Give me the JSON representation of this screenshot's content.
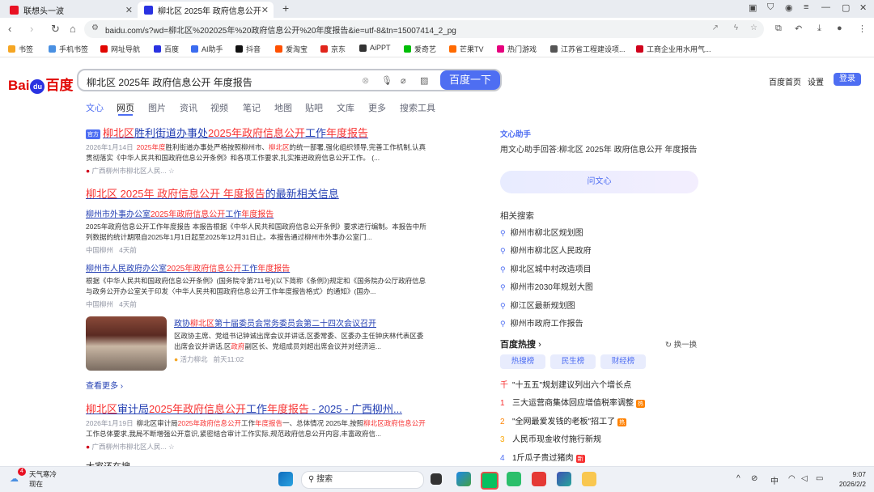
{
  "browser": {
    "tabs": [
      {
        "label": "联想头一波",
        "active": false
      },
      {
        "label": "柳北区 2025年 政府信息公开 年度",
        "active": true
      }
    ],
    "new_tab_glyph": "+",
    "url": "baidu.com/s?wd=柳北区%202025年%20政府信息公开%20年度报告&ie=utf-8&tn=15007414_2_pg",
    "bookmarks": [
      {
        "label": "书签",
        "color": "#f5a623"
      },
      {
        "label": "手机书签",
        "color": "#4a90e2"
      },
      {
        "label": "网址导航",
        "color": "#e10602"
      },
      {
        "label": "百度",
        "color": "#2932e1"
      },
      {
        "label": "AI助手",
        "color": "#3b6cf0"
      },
      {
        "label": "抖音",
        "color": "#111111"
      },
      {
        "label": "爱淘宝",
        "color": "#ff5000"
      },
      {
        "label": "京东",
        "color": "#e1251b"
      },
      {
        "label": "AiPPT",
        "color": "#333333"
      },
      {
        "label": "爱奇艺",
        "color": "#00be06"
      },
      {
        "label": "芒果TV",
        "color": "#ff6a00"
      },
      {
        "label": "热门游戏",
        "color": "#e6007e"
      },
      {
        "label": "江苏省工程建设项...",
        "color": "#555555"
      },
      {
        "label": "工商企业用水用气...",
        "color": "#d0021b"
      }
    ]
  },
  "search": {
    "logo_left": "Bai",
    "logo_du": "du",
    "logo_right": "百度",
    "query": "柳北区 2025年 政府信息公开 年度报告",
    "button": "百度一下",
    "links": [
      "百度首页",
      "设置"
    ],
    "login": "登录",
    "tabs": [
      "文心",
      "网页",
      "图片",
      "资讯",
      "视频",
      "笔记",
      "地图",
      "贴吧",
      "文库",
      "更多",
      "搜索工具"
    ]
  },
  "results": {
    "r1": {
      "badge": "官方",
      "t1": "柳北区",
      "t2": "胜利街道办事处",
      "t3": "2025年政府信息公开",
      "t4": "工作",
      "t5": "年度报告",
      "date": "2026年1月14日",
      "d1": "2025年度",
      "d2": "胜利街道办事处严格按照柳州市、",
      "d3": "柳北区",
      "d4": "的统一部署,强化组织领导,完善工作机制,认真贯彻落实《中华人民共和国政府信息公开条例》和各项工作要求,扎实推进政府信息公开工作。 (...",
      "source": "广西柳州市柳北区人民..."
    },
    "r2": {
      "title_em": "柳北区 2025年 政府信息公开 年度报告",
      "title_rest": "的最新相关信息",
      "a_t1": "柳州市外事办公室",
      "a_t2": "2025年政府信息公开",
      "a_t3": "工作",
      "a_t4": "年度报告",
      "a_desc": "2025年政府信息公开工作年度报告   本报告根据《中华人民共和国政府信息公开条例》要求进行编制。本报告中所列数据的统计期限自2025年1月1日起至2025年12月31日止。本报告通过柳州市外事办公室门...",
      "a_src": "中国柳州",
      "a_time": "4天前",
      "b_t1": "柳州市人民政府办公室",
      "b_t2": "2025年政府信息公开",
      "b_t3": "工作",
      "b_t4": "年度报告",
      "b_desc": "根据《中华人民共和国政府信息公开条例》(国务院令第711号)(以下简称《条例》)规定和《国务院办公厅政府信息与政务公开办公室关于印发〈中华人民共和国政府信息公开工作年度报告格式〉的通知》(国办...",
      "b_src": "中国柳州",
      "b_time": "4天前",
      "c_t1": "政协",
      "c_t2": "柳北区",
      "c_t3": "第十届委员会常务委员会第二十四次会议召开",
      "c_desc1": "区政协主席、党组书记钟诚出席会议并讲话,区委常委、区委办主任钟庆林代表区委出席会议并讲话,区",
      "c_desc_em": "政府",
      "c_desc2": "副区长、党组成员刘超出席会议并对经济运...",
      "c_src": "活力柳北",
      "c_time": "前天11:02",
      "more": "查看更多"
    },
    "r3": {
      "t1": "柳北区",
      "t2": "审计局",
      "t3": "2025年政府信息公开",
      "t4": "工作",
      "t5": "年度报告",
      "t6": " - 2025 - 广西柳州...",
      "date": "2026年1月19日",
      "d1": "柳北区审计局",
      "d2": "2025年政府信息公开",
      "d3": "工作",
      "d4": "年度报告",
      "d5": "一、总体情况 2025年,按照",
      "d6": "柳北区政府信息公开",
      "d7": "工作总体要求,我局不断增强公开意识,紧密结合审计工作实际,规范政府信息公开内容,丰富政府信...",
      "source": "广西柳州市柳北区人民..."
    },
    "r4_partial": "大家还在搜"
  },
  "sidebar": {
    "wenxin_label": "文心助手",
    "wenxin_answer": "用文心助手回答:柳北区 2025年 政府信息公开 年度报告",
    "wenxin_btn": "问文心",
    "related_title": "相关搜索",
    "related": [
      "柳州市柳北区规划图",
      "柳州市柳北区人民政府",
      "柳北区城中村改造项目",
      "柳州市2030年规划大图",
      "柳江区最新规划图",
      "柳州市政府工作报告"
    ],
    "hot_title": "百度热搜",
    "hot_change": "换一换",
    "hot_tabs": [
      "热搜榜",
      "民生榜",
      "财经榜"
    ],
    "hot": [
      {
        "n": "千",
        "text": "\"十五五\"规划建议列出六个增长点",
        "tag": ""
      },
      {
        "n": "1",
        "text": "三大运营商集体回应增值税率调整",
        "tag": "热"
      },
      {
        "n": "2",
        "text": "\"全网最爱发钱的老板\"招工了",
        "tag": "热"
      },
      {
        "n": "3",
        "text": "人民币现金收付施行新规",
        "tag": ""
      },
      {
        "n": "4",
        "text": "1斤瓜子贵过猪肉",
        "tag": "新"
      }
    ]
  },
  "taskbar": {
    "weather_title": "天气寒冷",
    "weather_sub": "现在",
    "badge": "4",
    "search": "搜索",
    "ime": "中",
    "time": "9:07",
    "date": "2026/2/2"
  }
}
